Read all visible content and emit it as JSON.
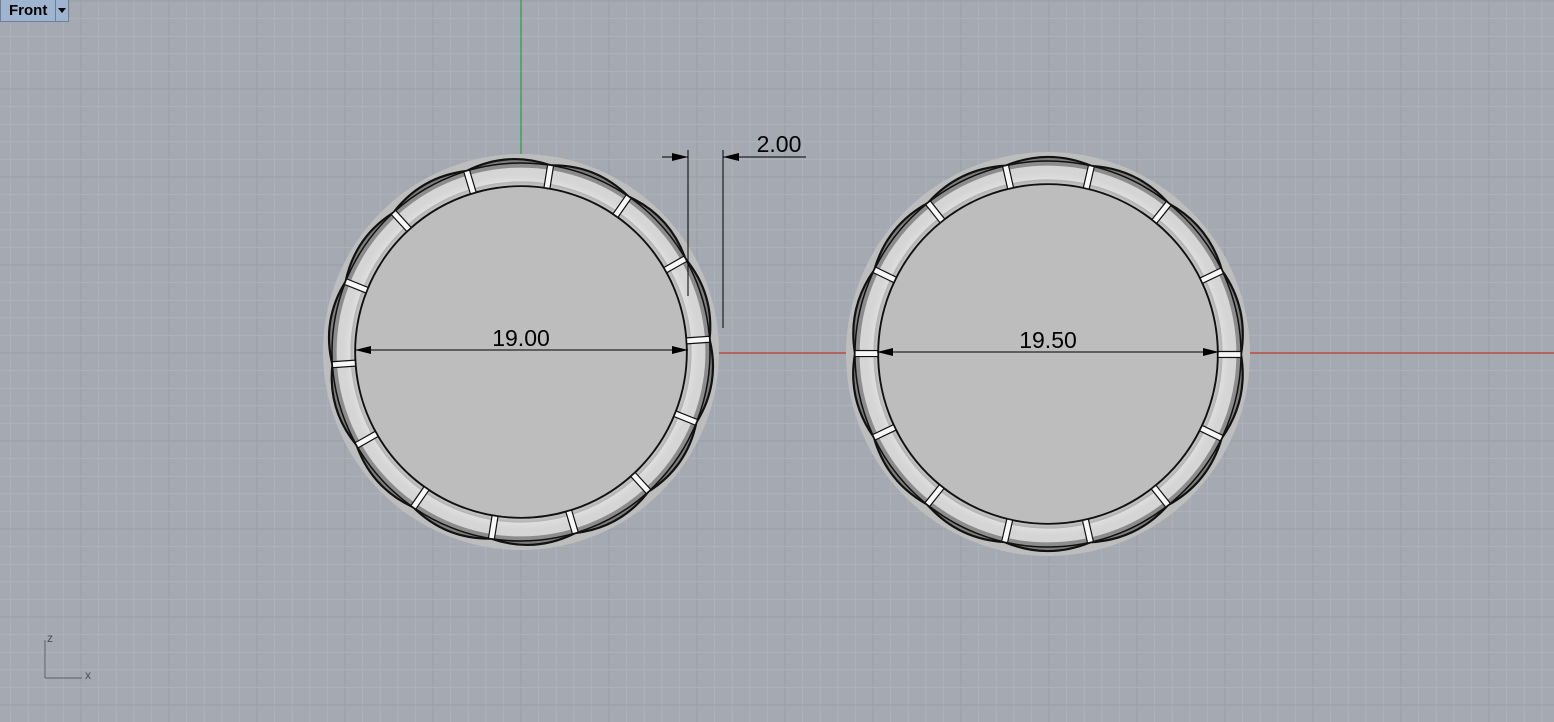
{
  "viewport": {
    "name": "Front",
    "menu_icon": "triangle-down-icon"
  },
  "dimensions": {
    "left_ring_inner_diameter": "19.00",
    "right_ring_inner_diameter": "19.50",
    "band_width": "2.00"
  },
  "axis_icon": {
    "vertical": "z",
    "horizontal": "x"
  },
  "colors": {
    "background": "#a4a9b2",
    "grid_minor": "#aeb3bb",
    "grid_major": "#989da6",
    "x_axis": "#c0392b",
    "z_axis": "#2e9e3e",
    "label_bg": "#9fb4cf"
  }
}
